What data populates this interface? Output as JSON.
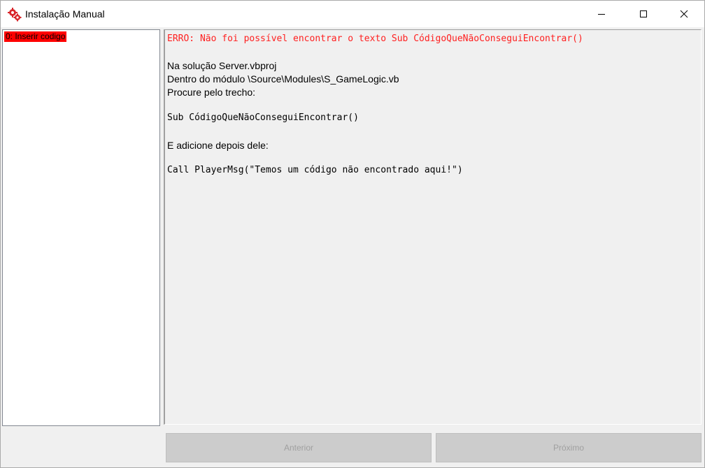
{
  "window": {
    "title": "Instalação Manual"
  },
  "list": {
    "items": [
      "0: Inserir codigo"
    ],
    "selected_color": "#ff0000"
  },
  "content": {
    "error_line": "ERRO: Não foi possível encontrar o texto Sub CódigoQueNãoConseguiEncontrar()",
    "solution_line": "Na solução Server.vbproj",
    "module_line": "Dentro do módulo \\Source\\Modules\\S_GameLogic.vb",
    "search_line": "Procure pelo trecho:",
    "code_search": "Sub CódigoQueNãoConseguiEncontrar()",
    "add_line": "E adicione depois dele:",
    "code_insert": "Call PlayerMsg(\"Temos um código não encontrado aqui!\")",
    "error_color": "#ff2020"
  },
  "buttons": {
    "previous": "Anterior",
    "next": "Próximo"
  }
}
